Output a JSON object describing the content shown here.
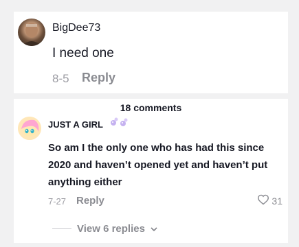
{
  "first_comment": {
    "username": "BigDee73",
    "text": "I need one",
    "date": "8-5",
    "reply_label": "Reply"
  },
  "second_comment": {
    "count_label": "18 comments",
    "username": "JUST A GIRL",
    "text": "So am I the only one who has had this since 2020 and haven’t opened yet and haven’t put anything either",
    "date": "7-27",
    "reply_label": "Reply",
    "like_count": "31",
    "view_replies_label": "View 6 replies"
  },
  "icons": {
    "like": "heart-outline-icon",
    "expand": "chevron-down-icon",
    "decor": "bubbles-emoji"
  },
  "colors": {
    "background": "#f1f1f2",
    "card": "#ffffff",
    "text_primary": "#161823",
    "text_secondary": "#8a8b91",
    "username_decor": "#b9a2e8"
  }
}
